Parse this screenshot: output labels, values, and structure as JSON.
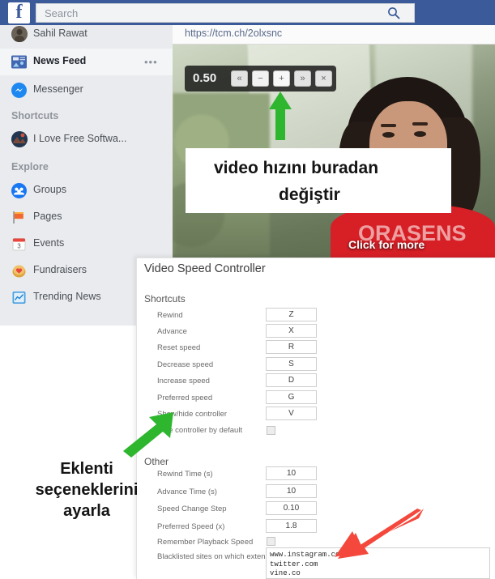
{
  "header": {
    "logo": "f",
    "search_placeholder": "Search",
    "search_icon": "search-icon",
    "bar_color": "#3b5a9a"
  },
  "sidebar": {
    "user": {
      "name": "Sahil Rawat",
      "avatar": "user-avatar"
    },
    "items": [
      {
        "label": "News Feed",
        "icon": "news-feed-icon",
        "active": true,
        "more": "•••"
      },
      {
        "label": "Messenger",
        "icon": "messenger-icon",
        "active": false
      }
    ],
    "sections": [
      {
        "heading": "Shortcuts",
        "items": [
          {
            "label": "I Love Free Softwa...",
            "icon": "page-avatar-icon"
          }
        ]
      },
      {
        "heading": "Explore",
        "items": [
          {
            "label": "Groups",
            "icon": "groups-icon"
          },
          {
            "label": "Pages",
            "icon": "flag-icon"
          },
          {
            "label": "Events",
            "icon": "calendar-icon"
          },
          {
            "label": "Fundraisers",
            "icon": "heart-jar-icon"
          },
          {
            "label": "Trending News",
            "icon": "trending-chart-icon"
          }
        ]
      }
    ]
  },
  "video": {
    "url": "https://tcm.ch/2olxsnc",
    "click_for_more": "Click for more",
    "shirt_text": "ORASENS",
    "controller": {
      "speed": "0.50",
      "buttons": [
        {
          "name": "rewind-button",
          "glyph": "«"
        },
        {
          "name": "decrease-speed-button",
          "glyph": "−"
        },
        {
          "name": "increase-speed-button",
          "glyph": "+"
        },
        {
          "name": "advance-button",
          "glyph": "»"
        },
        {
          "name": "close-controller-button",
          "glyph": "×"
        }
      ]
    }
  },
  "annotations": {
    "top": {
      "line1": "video hızını buradan",
      "line2": "değiştir",
      "arrow": "green-arrow-up"
    },
    "bottom": {
      "line1": "Eklenti",
      "line2": "seçeneklerini",
      "line3": "ayarla",
      "arrow": "green-arrow-up-right"
    },
    "red_arrow": "red-arrow-down-left",
    "arrow_green_color": "#2fb62f",
    "arrow_red_color": "#f4483c"
  },
  "panel": {
    "title": "Video Speed Controller",
    "sections": [
      {
        "heading": "Shortcuts",
        "rows": [
          {
            "label": "Rewind",
            "type": "text",
            "value": "Z"
          },
          {
            "label": "Advance",
            "type": "text",
            "value": "X"
          },
          {
            "label": "Reset speed",
            "type": "text",
            "value": "R"
          },
          {
            "label": "Decrease speed",
            "type": "text",
            "value": "S"
          },
          {
            "label": "Increase speed",
            "type": "text",
            "value": "D"
          },
          {
            "label": "Preferred speed",
            "type": "text",
            "value": "G"
          },
          {
            "label": "Show/hide controller",
            "type": "text",
            "value": "V"
          },
          {
            "label": "Hide controller by default",
            "type": "checkbox",
            "checked": false
          }
        ]
      },
      {
        "heading": "Other",
        "rows": [
          {
            "label": "Rewind Time (s)",
            "type": "text",
            "value": "10"
          },
          {
            "label": "Advance Time (s)",
            "type": "text",
            "value": "10"
          },
          {
            "label": "Speed Change Step",
            "type": "text",
            "value": "0.10"
          },
          {
            "label": "Preferred Speed (x)",
            "type": "text",
            "value": "1.8"
          },
          {
            "label": "Remember Playback Speed",
            "type": "checkbox",
            "checked": false
          },
          {
            "label": "Blacklisted sites on which\nextension is disabled\n(one per line)",
            "type": "textarea",
            "value": "www.instagram.com\ntwitter.com\nvine.co"
          }
        ]
      }
    ]
  }
}
